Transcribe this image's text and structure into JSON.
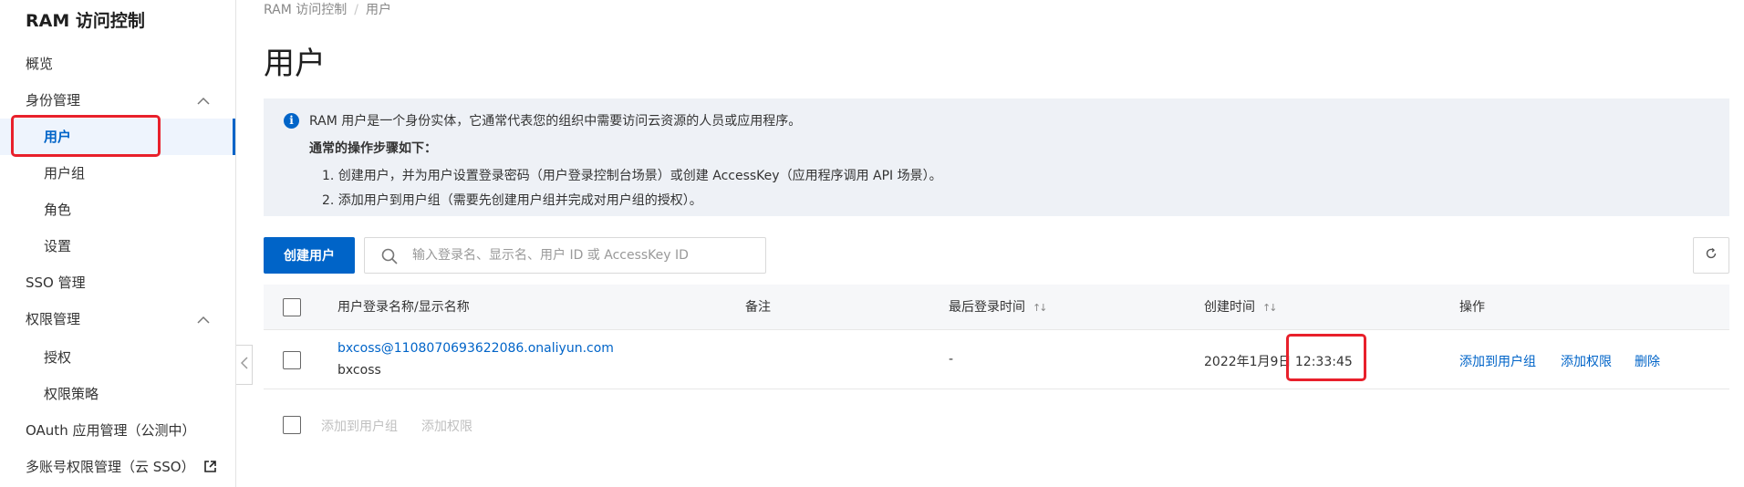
{
  "sidebar": {
    "title": "RAM 访问控制",
    "items": [
      {
        "label": "概览"
      },
      {
        "label": "身份管理"
      },
      {
        "label": "用户"
      },
      {
        "label": "用户组"
      },
      {
        "label": "角色"
      },
      {
        "label": "设置"
      },
      {
        "label": "SSO 管理"
      },
      {
        "label": "权限管理"
      },
      {
        "label": "授权"
      },
      {
        "label": "权限策略"
      },
      {
        "label": "OAuth 应用管理（公测中）"
      },
      {
        "label": "多账号权限管理（云 SSO）"
      }
    ]
  },
  "breadcrumb": {
    "root": "RAM 访问控制",
    "sep": "/",
    "current": "用户"
  },
  "page_title": "用户",
  "info": {
    "line1": "RAM 用户是一个身份实体，它通常代表您的组织中需要访问云资源的人员或应用程序。",
    "heading": "通常的操作步骤如下：",
    "step1": "1. 创建用户，并为用户设置登录密码（用户登录控制台场景）或创建 AccessKey（应用程序调用 API 场景）。",
    "step2": "2. 添加用户到用户组（需要先创建用户组并完成对用户组的授权）。"
  },
  "toolbar": {
    "create_label": "创建用户",
    "search_placeholder": "输入登录名、显示名、用户 ID 或 AccessKey ID"
  },
  "table": {
    "columns": [
      "用户登录名称/显示名称",
      "备注",
      "最后登录时间",
      "创建时间",
      "操作"
    ],
    "rows": [
      {
        "login_name": "bxcoss@1108070693622086.onaliyun.com",
        "display_name": "bxcoss",
        "remark": "",
        "last_login": "-",
        "created": "2022年1月9日 12:33:45",
        "actions": [
          "添加到用户组",
          "添加权限",
          "删除"
        ]
      }
    ]
  },
  "bulk_actions": [
    "添加到用户组",
    "添加权限"
  ],
  "colors": {
    "primary": "#0064c8",
    "highlight": "#e8202b",
    "info_bg": "#eef1f6"
  }
}
